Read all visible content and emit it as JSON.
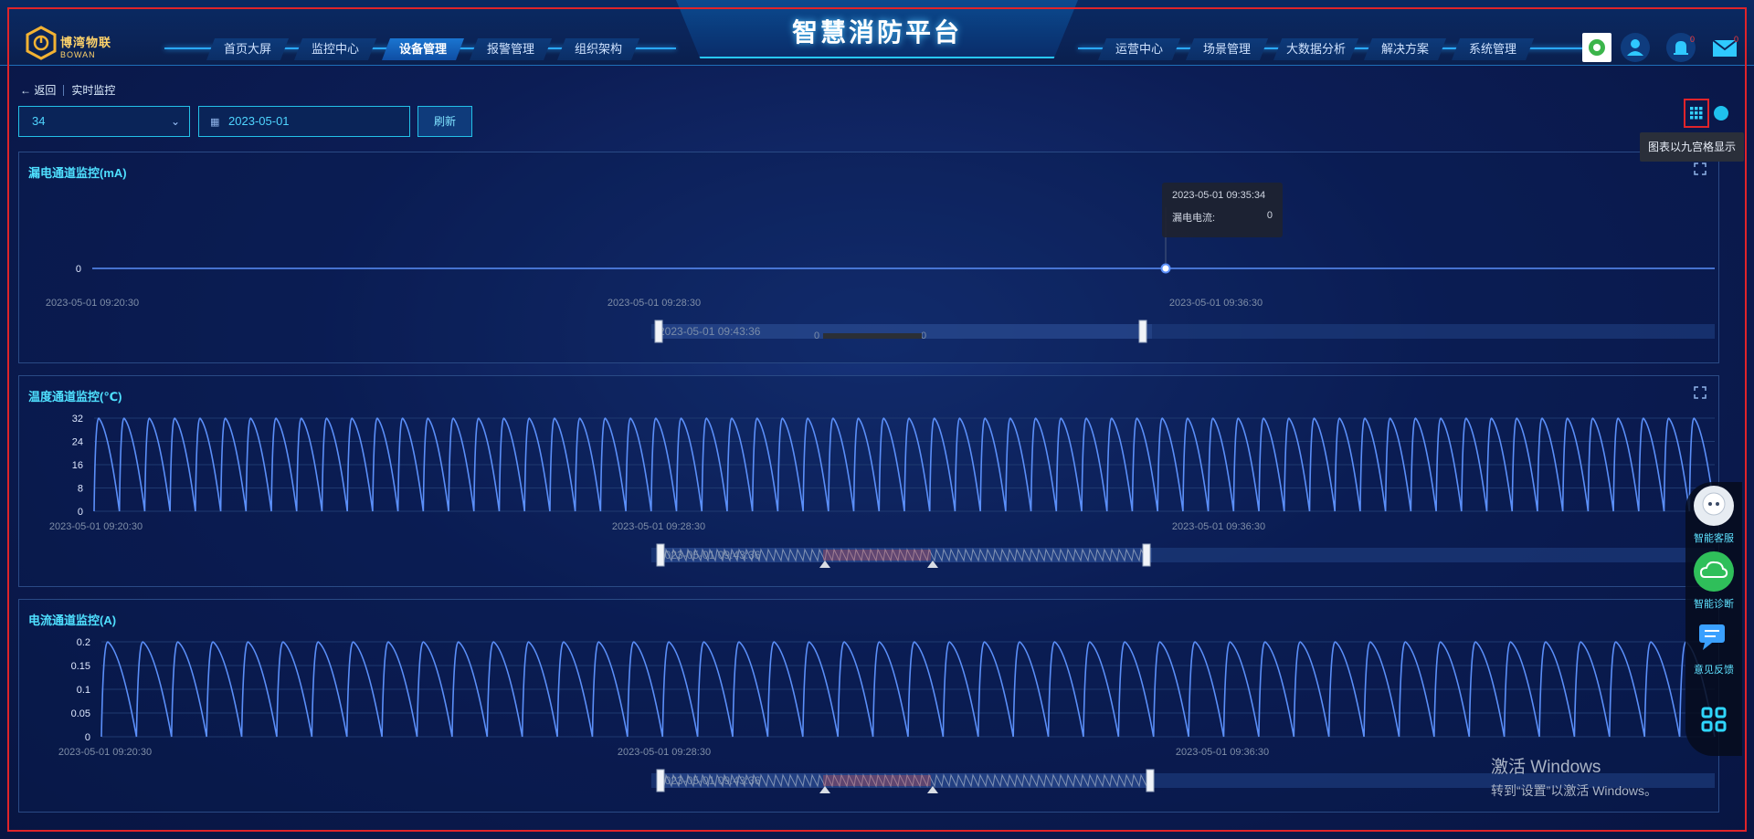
{
  "header": {
    "app_title": "智慧消防平台",
    "logo_cn": "博湾物联",
    "logo_en": "BOWAN",
    "nav_left": [
      "首页大屏",
      "监控中心",
      "设备管理",
      "报警管理",
      "组织架构"
    ],
    "nav_right": [
      "运营中心",
      "场景管理",
      "大数据分析",
      "解决方案",
      "系统管理"
    ],
    "active_nav": "设备管理",
    "alarm_badge": "0",
    "msg_badge": "0"
  },
  "toolbar": {
    "back_label": "返回",
    "page_label": "实时监控",
    "device_select": "34",
    "date_value": "2023-05-01",
    "refresh_label": "刷新",
    "grid_tooltip": "图表以九宫格显示"
  },
  "colors": {
    "accent": "#4fe0ff",
    "line": "#5b8ff9",
    "panel_border": "#2a4a85"
  },
  "tooltip": {
    "time": "2023-05-01 09:35:34",
    "label": "漏电电流:",
    "value": "0"
  },
  "chart_data": [
    {
      "type": "line",
      "title": "漏电通道监控(mA)",
      "x_ticks": [
        "2023-05-01 09:20:30",
        "2023-05-01 09:28:30",
        "2023-05-01 09:36:30"
      ],
      "y_ticks": [
        "0"
      ],
      "ylim": [
        0,
        0
      ],
      "values": [
        0,
        0
      ],
      "slider_start_label": "2023-05-01 09:43:36",
      "slider_value_left": "0",
      "slider_value_right": "0"
    },
    {
      "type": "line",
      "title": "温度通道监控(℃)",
      "x_ticks": [
        "2023-05-01 09:20:30",
        "2023-05-01 09:28:30",
        "2023-05-01 09:36:30"
      ],
      "y_ticks": [
        "0",
        "8",
        "16",
        "24",
        "32"
      ],
      "ylim": [
        0,
        32
      ],
      "peak": 32,
      "cycles": 64,
      "slider_start_label": "2023-05-01 09:43:36"
    },
    {
      "type": "line",
      "title": "电流通道监控(A)",
      "x_ticks": [
        "2023-05-01 09:20:30",
        "2023-05-01 09:28:30",
        "2023-05-01 09:36:30"
      ],
      "y_ticks": [
        "0",
        "0.05",
        "0.1",
        "0.15",
        "0.2"
      ],
      "ylim": [
        0,
        0.2
      ],
      "peak": 0.2,
      "cycles": 46,
      "slider_start_label": "2023-05-01 09:43:36"
    }
  ],
  "float_tools": [
    "智能客服",
    "智能诊断",
    "意见反馈"
  ],
  "watermark": {
    "line1": "激活 Windows",
    "line2": "转到“设置”以激活 Windows。"
  }
}
